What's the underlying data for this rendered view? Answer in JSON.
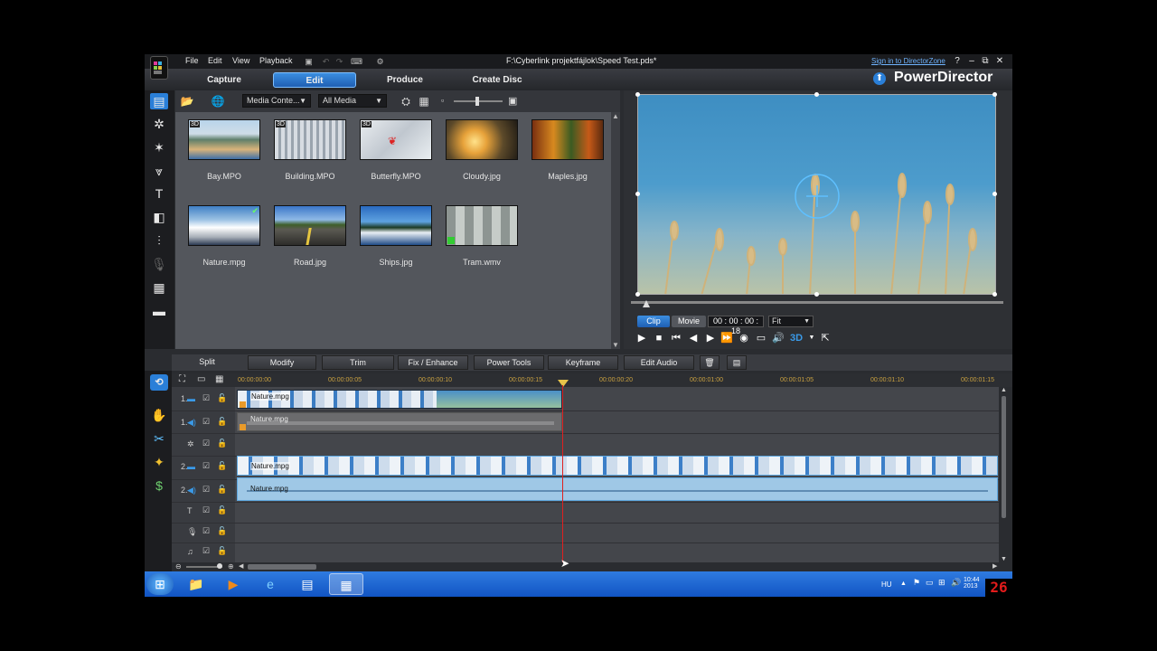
{
  "titlebar": {
    "menu": [
      "File",
      "Edit",
      "View",
      "Playback"
    ],
    "document_title": "F:\\Cyberlink projektfájlok\\Speed Test.pds*",
    "signin": "Sign in to DirectorZone",
    "help": "?",
    "minimize": "–",
    "restore": "⧉",
    "close": "✕"
  },
  "modebar": {
    "tabs": [
      "Capture",
      "Edit",
      "Produce",
      "Create Disc"
    ],
    "active_tab": "Edit",
    "brand": "PowerDirector"
  },
  "library": {
    "filter1": "Media Conte...",
    "filter2": "All Media",
    "items": [
      {
        "name": "Bay.MPO",
        "badge": "3D"
      },
      {
        "name": "Building.MPO",
        "badge": "3D"
      },
      {
        "name": "Butterfly.MPO",
        "badge": "3D"
      },
      {
        "name": "Cloudy.jpg",
        "badge": ""
      },
      {
        "name": "Maples.jpg",
        "badge": ""
      },
      {
        "name": "Nature.mpg",
        "badge": ""
      },
      {
        "name": "Road.jpg",
        "badge": ""
      },
      {
        "name": "Ships.jpg",
        "badge": ""
      },
      {
        "name": "Tram.wmv",
        "badge": ""
      }
    ]
  },
  "preview": {
    "mode_clip": "Clip",
    "mode_movie": "Movie",
    "active_mode": "Clip",
    "timecode": "00 : 00 : 00 : 18",
    "fit": "Fit",
    "seek_position": 0.03
  },
  "edit_toolbar": [
    "Split",
    "Modify",
    "Trim",
    "Fix / Enhance",
    "Power Tools",
    "Keyframe",
    "Edit Audio"
  ],
  "timeline": {
    "ruler": [
      "00:00:00:00",
      "00:00:00:05",
      "00:00:00:10",
      "00:00:00:15",
      "00:00:00:20",
      "00:00:01:00",
      "00:00:01:05",
      "00:00:01:10",
      "00:00:01:15"
    ],
    "track_numbers": [
      "1.",
      "1.",
      "2.",
      "2."
    ],
    "clips": {
      "video1": "Nature.mpg",
      "audio1": "Nature.mpg",
      "video2": "Nature.mpg",
      "audio2": "Nature.mpg"
    }
  },
  "taskbar": {
    "language": "HU",
    "time": "10:44",
    "date": "2013",
    "counter": "26"
  },
  "colors": {
    "accent": "#2a7fd8",
    "clip_blue": "#9fc8e6",
    "playhead": "#e02020"
  }
}
